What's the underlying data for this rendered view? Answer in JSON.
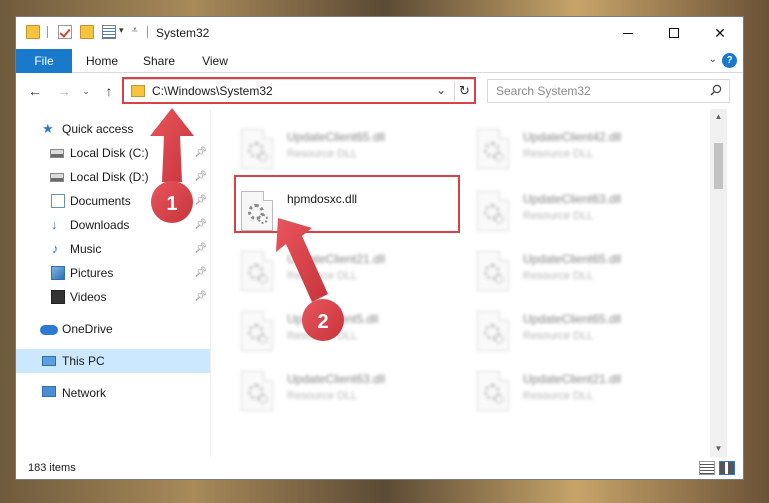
{
  "window": {
    "title": "System32"
  },
  "ribbon": {
    "tabs": [
      {
        "label": "File"
      },
      {
        "label": "Home"
      },
      {
        "label": "Share"
      },
      {
        "label": "View"
      }
    ]
  },
  "address": {
    "path": "C:\\Windows\\System32"
  },
  "search": {
    "placeholder": "Search System32"
  },
  "sidebar": {
    "items": [
      {
        "label": "Quick access",
        "icon": "star-icon"
      },
      {
        "label": "Local Disk (C:)",
        "icon": "drive-icon",
        "pinned": true
      },
      {
        "label": "Local Disk (D:)",
        "icon": "drive-icon",
        "pinned": true
      },
      {
        "label": "Documents",
        "icon": "documents-icon",
        "pinned": true
      },
      {
        "label": "Downloads",
        "icon": "download-icon",
        "pinned": true
      },
      {
        "label": "Music",
        "icon": "music-icon",
        "pinned": true
      },
      {
        "label": "Pictures",
        "icon": "pictures-icon",
        "pinned": true
      },
      {
        "label": "Videos",
        "icon": "videos-icon",
        "pinned": true
      },
      {
        "label": "OneDrive",
        "icon": "onedrive-icon"
      },
      {
        "label": "This PC",
        "icon": "pc-icon",
        "selected": true
      },
      {
        "label": "Network",
        "icon": "network-icon"
      }
    ]
  },
  "files": {
    "left": [
      {
        "name": "UpdateClient65.dll",
        "type": "Resource DLL",
        "blurred": true
      },
      {
        "name": "hpmdosxc.dll",
        "type": "",
        "blurred": false,
        "highlighted": true
      },
      {
        "name": "UpdateClient21.dll",
        "type": "Resource DLL",
        "blurred": true
      },
      {
        "name": "UpdateClient5.dll",
        "type": "Resource DLL",
        "blurred": true
      },
      {
        "name": "UpdateClient63.dll",
        "type": "Resource DLL",
        "blurred": true
      }
    ],
    "right": [
      {
        "name": "UpdateClient42.dll",
        "type": "Resource DLL",
        "blurred": true
      },
      {
        "name": "UpdateClient63.dll",
        "type": "Resource DLL",
        "blurred": true
      },
      {
        "name": "UpdateClient65.dll",
        "type": "Resource DLL",
        "blurred": true
      },
      {
        "name": "UpdateClient65.dll",
        "type": "Resource DLL",
        "blurred": true
      },
      {
        "name": "UpdateClient21.dll",
        "type": "Resource DLL",
        "blurred": true
      }
    ]
  },
  "status": {
    "item_count": "183 items"
  },
  "annotations": {
    "step1": "1",
    "step2": "2",
    "color": "#d9414a"
  },
  "colors": {
    "accent": "#1979ca",
    "selected_bg": "#cce8ff"
  }
}
